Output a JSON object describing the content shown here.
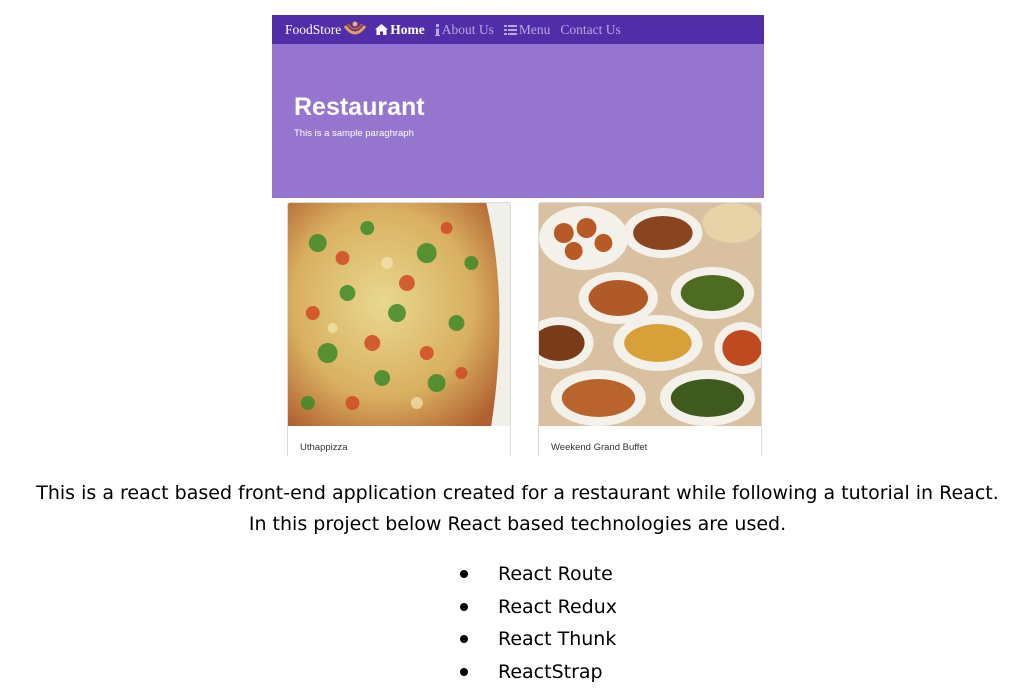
{
  "app": {
    "brand": "FoodStore",
    "nav": [
      {
        "label": "Home",
        "icon": "home-icon",
        "active": true
      },
      {
        "label": "About Us",
        "icon": "info-icon",
        "active": false
      },
      {
        "label": "Menu",
        "icon": "list-icon",
        "active": false
      },
      {
        "label": "Contact Us",
        "icon": "",
        "active": false
      }
    ],
    "jumbotron": {
      "title": "Restaurant",
      "text": "This is a sample paraghraph"
    },
    "cards": [
      {
        "title": "Uthappizza",
        "image": "pizza"
      },
      {
        "title": "Weekend Grand Buffet",
        "image": "buffet"
      }
    ],
    "colors": {
      "navbar": "#512da8",
      "jumbotron": "#9575cd"
    }
  },
  "doc": {
    "line1": "This is a react based front-end application created for a restaurant while following a tutorial in React.",
    "line2": "In this project below React based technologies are used.",
    "technologies": [
      "React Route",
      "React Redux",
      "React Thunk",
      "ReactStrap"
    ]
  }
}
